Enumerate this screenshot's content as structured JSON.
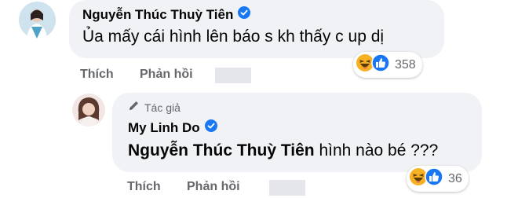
{
  "comment1": {
    "author": "Nguyễn Thúc Thuỳ Tiên",
    "text": "Ủa mấy cái hình lên báo s kh thấy c up dị",
    "reaction_count": "358",
    "actions": {
      "like": "Thích",
      "reply": "Phản hồi"
    }
  },
  "reply1": {
    "author_badge": "Tác giả",
    "author": "My Linh Do",
    "mention": "Nguyễn Thúc Thuỳ Tiên",
    "text": " hình nào bé ???",
    "reaction_count": "36",
    "actions": {
      "like": "Thích",
      "reply": "Phản hồi"
    }
  },
  "colors": {
    "bubble": "#f0f2f5",
    "verified": "#1877f2",
    "secondary_text": "#65676b"
  },
  "icons": [
    "verified-badge-icon",
    "haha-reaction-icon",
    "like-reaction-icon",
    "pencil-icon"
  ]
}
